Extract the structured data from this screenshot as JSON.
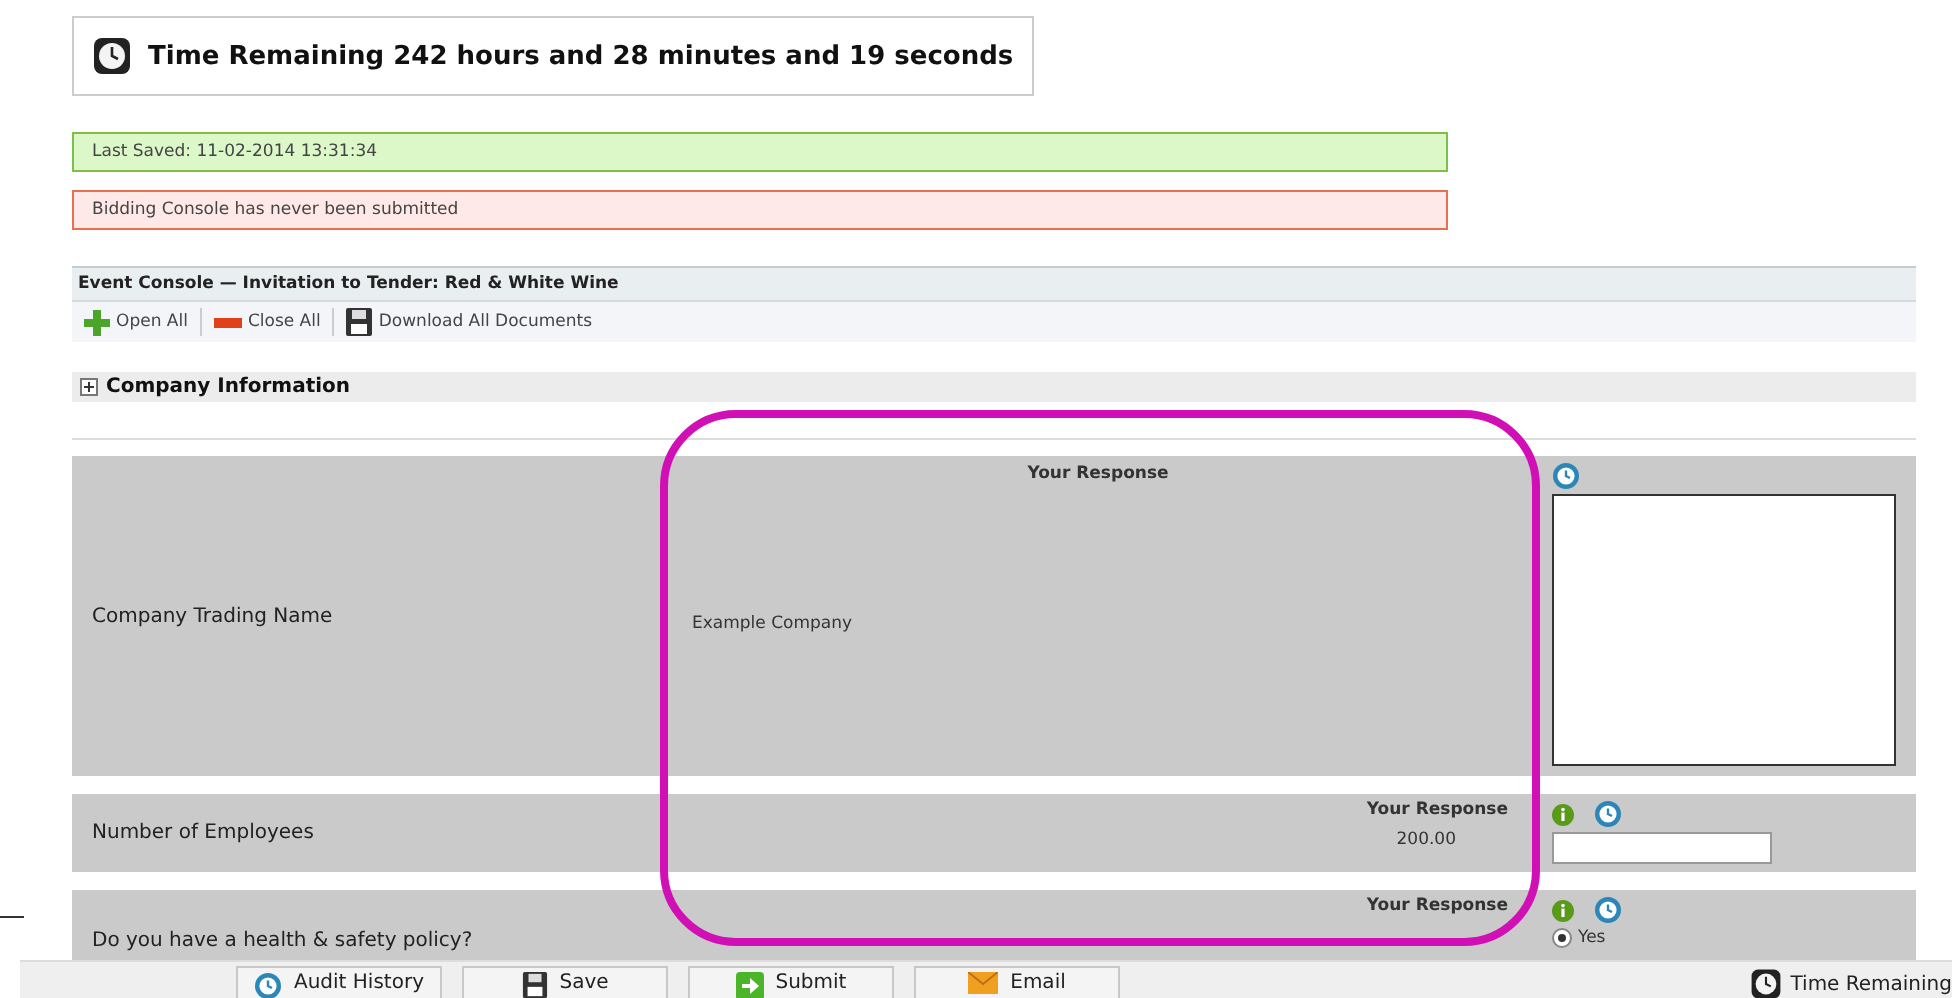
{
  "timer": {
    "text": "Time Remaining 242 hours and 28 minutes and 19 seconds"
  },
  "notices": [
    {
      "kind": "success",
      "text": "Last Saved: 11-02-2014 13:31:34"
    },
    {
      "kind": "error",
      "text": "Bidding Console has never been submitted"
    }
  ],
  "console": {
    "title": "Event Console — Invitation to Tender: Red & White Wine",
    "actions": [
      {
        "kind": "open",
        "label": "Open All"
      },
      {
        "kind": "close",
        "label": "Close All"
      },
      {
        "kind": "download",
        "label": "Download All Documents"
      }
    ]
  },
  "section": {
    "title": "Company Information",
    "expanded": false
  },
  "questions": [
    {
      "kind": "text_area",
      "label": "Company Trading Name",
      "response_heading": "Your Response",
      "response": "Example Company"
    },
    {
      "kind": "number",
      "label": "Number of Employees",
      "response_heading": "Your Response",
      "response": "200.00"
    },
    {
      "kind": "radio",
      "label": "Do you have a health & safety policy?",
      "response_heading": "Your Response",
      "options": [
        {
          "label": "Yes",
          "selected": true
        }
      ]
    }
  ],
  "footer": {
    "buttons": [
      {
        "kind": "history",
        "label": "Audit History"
      },
      {
        "kind": "save",
        "label": "Save"
      },
      {
        "kind": "submit",
        "label": "Submit"
      },
      {
        "kind": "email",
        "label": "Email"
      }
    ],
    "timer": "Time Remaining"
  }
}
